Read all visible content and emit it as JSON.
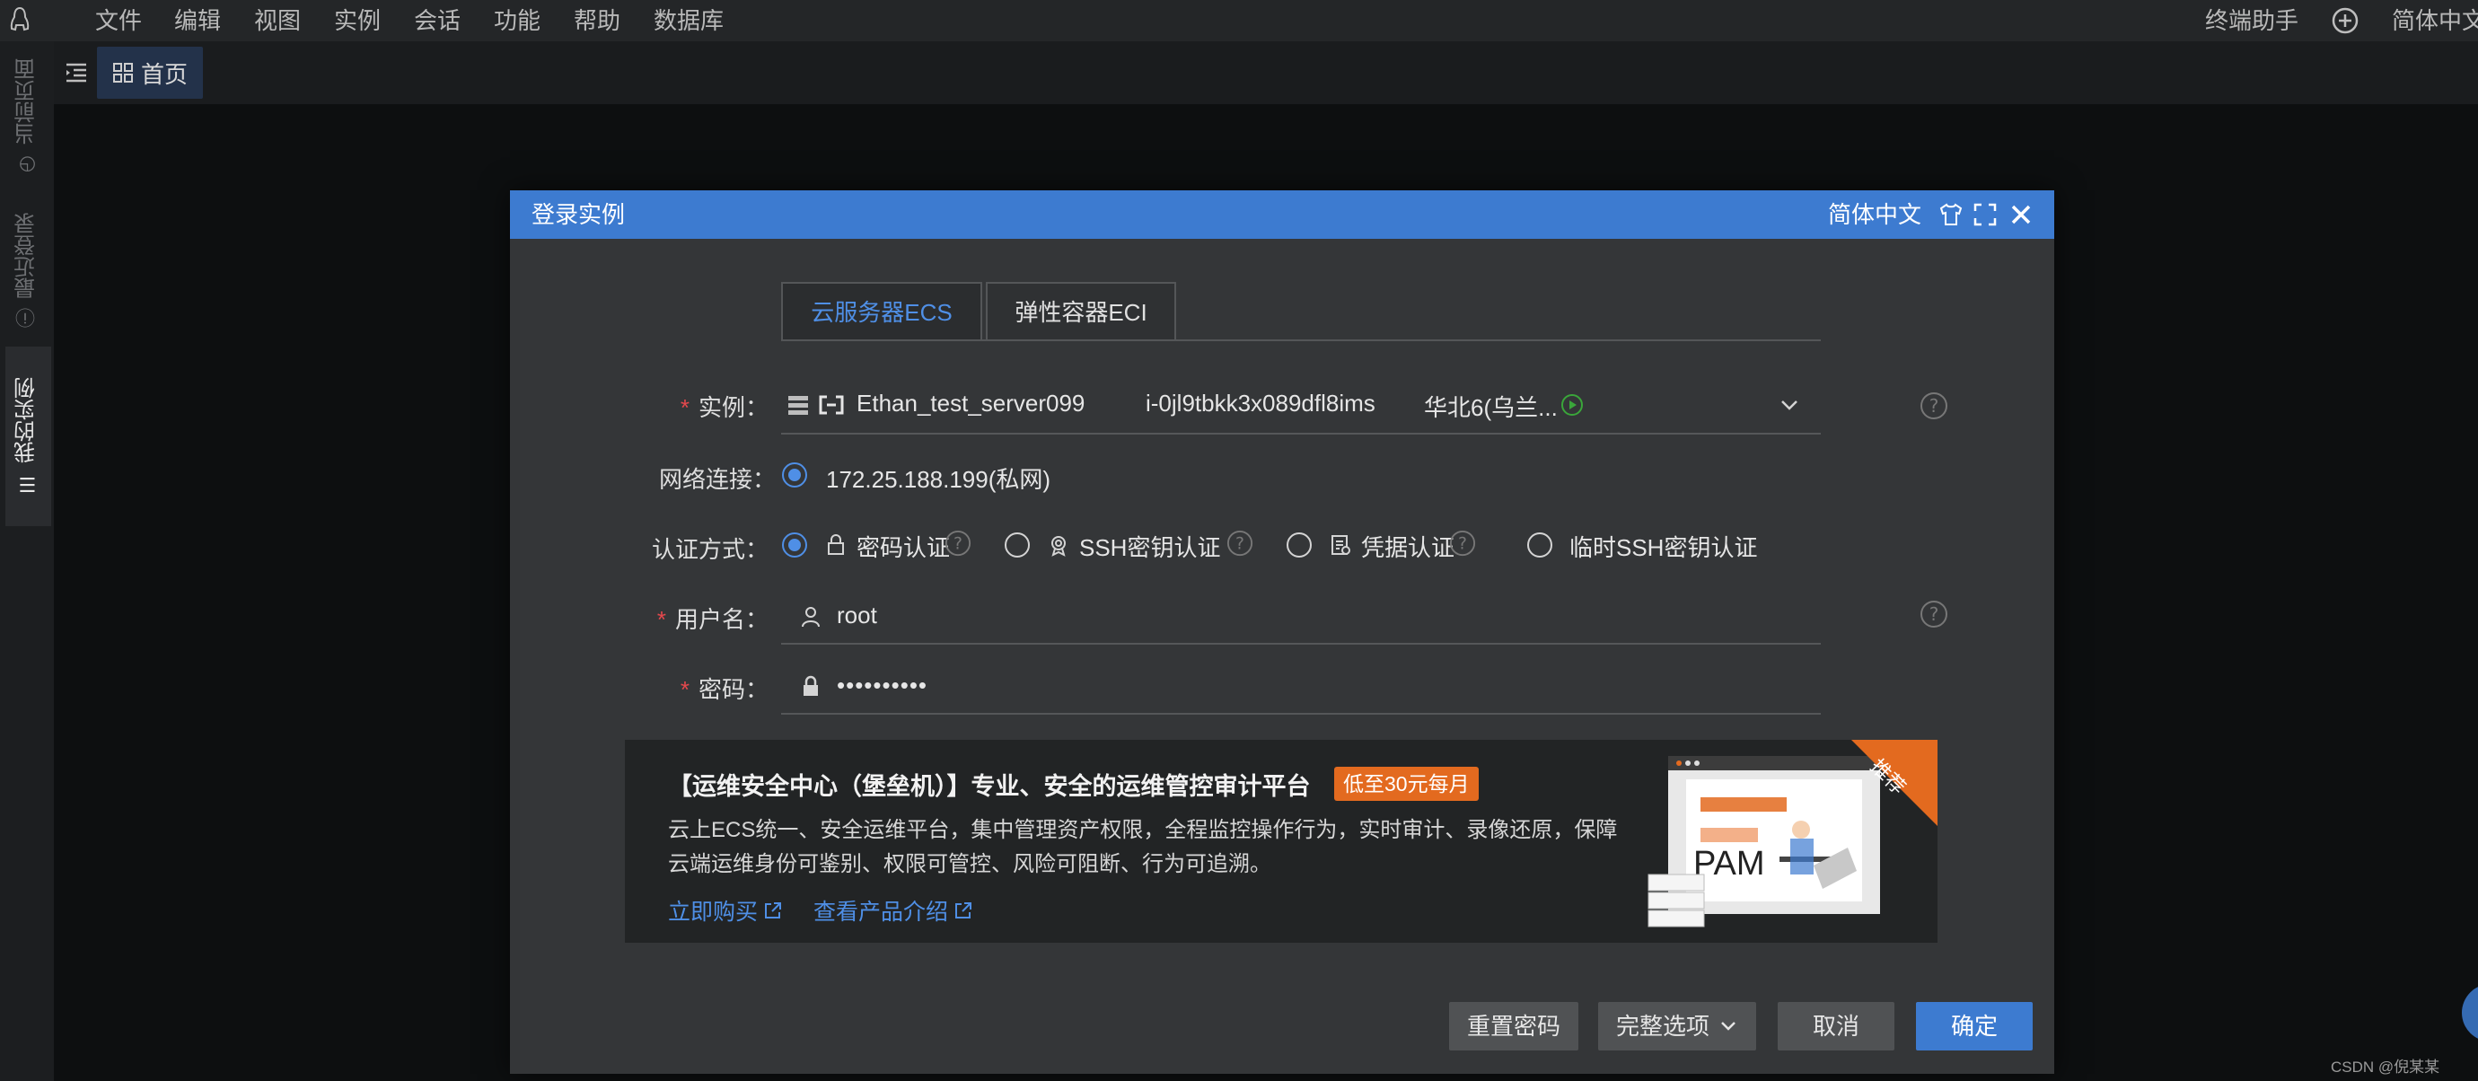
{
  "menubar": {
    "items": [
      "文件",
      "编辑",
      "视图",
      "实例",
      "会话",
      "功能",
      "帮助",
      "数据库"
    ],
    "assistant": "终端助手",
    "language": "简体中文"
  },
  "sidebar": {
    "tabs": [
      "当前页面",
      "最近登录",
      "我的实例"
    ]
  },
  "tabbar": {
    "home_label": "首页"
  },
  "dialog": {
    "title": "登录实例",
    "language": "简体中文",
    "tabs": [
      "云服务器ECS",
      "弹性容器ECI"
    ],
    "instance_label": "实例：",
    "instance": {
      "name": "Ethan_test_server099",
      "id": "i-0jl9tbkk3x089dfl8ims",
      "region": "华北6(乌兰..."
    },
    "network_label": "网络连接：",
    "network_value": "172.25.188.199(私网)",
    "auth_label": "认证方式：",
    "auth_options": [
      "密码认证",
      "SSH密钥认证",
      "凭据认证",
      "临时SSH密钥认证"
    ],
    "username_label": "用户名：",
    "username_value": "root",
    "password_label": "密码：",
    "password_value": "••••••••••",
    "banner": {
      "title": "【运维安全中心（堡垒机）】专业、安全的运维管控审计平台",
      "badge": "低至30元每月",
      "desc_line1": "云上ECS统一、安全运维平台，集中管理资产权限，全程监控操作行为，实时审计、录像还原，保障",
      "desc_line2": "云端运维身份可鉴别、权限可管控、风险可阻断、行为可追溯。",
      "link_buy": "立即购买",
      "link_intro": "查看产品介绍",
      "ribbon": "推荐",
      "art_text": "PAM"
    },
    "buttons": {
      "reset_password": "重置密码",
      "full_options": "完整选项",
      "cancel": "取消",
      "confirm": "确定"
    }
  },
  "watermark": "CSDN @倪某某",
  "colors": {
    "accent": "#3d7bd0",
    "link": "#4f8fe6",
    "badge": "#e36a1f",
    "required": "#e5484d",
    "run_status": "#3aa63a"
  }
}
